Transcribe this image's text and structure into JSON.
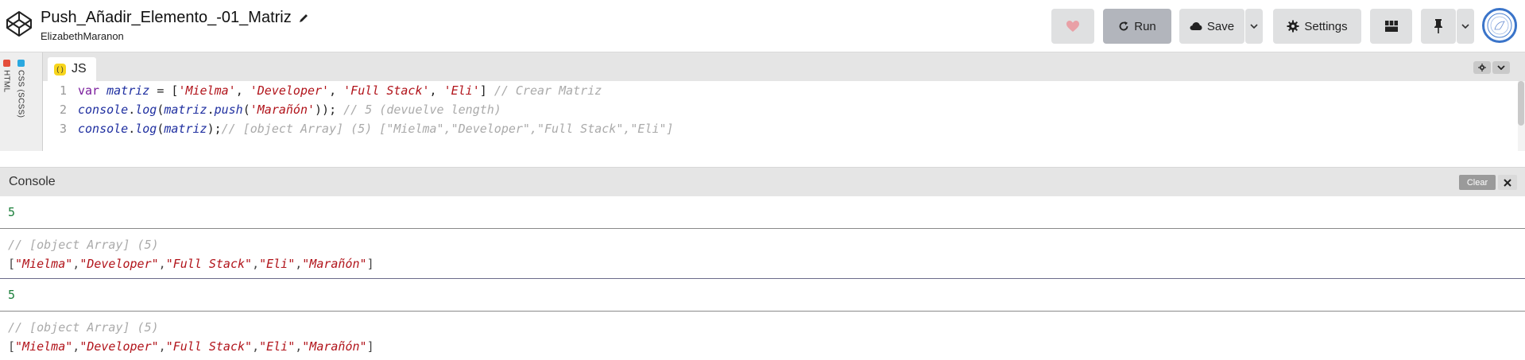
{
  "header": {
    "pen_title": "Push_Añadir_Elemento_-01_Matriz",
    "author": "ElizabethMaranon",
    "run_label": "Run",
    "save_label": "Save",
    "settings_label": "Settings"
  },
  "side_panels": {
    "html_label": "HTML",
    "css_label": "CSS (SCSS)"
  },
  "editor": {
    "tab_label": "JS",
    "line_numbers": [
      "1",
      "2",
      "3"
    ]
  },
  "console": {
    "title": "Console",
    "clear_label": "Clear",
    "entries": [
      {
        "value": "5"
      },
      {
        "comment": "// [object Array] (5)",
        "items": [
          "\"Mielma\"",
          "\"Developer\"",
          "\"Full Stack\"",
          "\"Eli\"",
          "\"Marañón\""
        ]
      },
      {
        "value": "5"
      },
      {
        "comment": "// [object Array] (5)",
        "items": [
          "\"Mielma\"",
          "\"Developer\"",
          "\"Full Stack\"",
          "\"Eli\"",
          "\"Marañón\""
        ]
      }
    ]
  },
  "colors": {
    "accent_run": "#b2b5bc",
    "js_badge": "#f7d51d",
    "html_badge": "#e44d3a",
    "css_badge": "#2aa8e0"
  }
}
